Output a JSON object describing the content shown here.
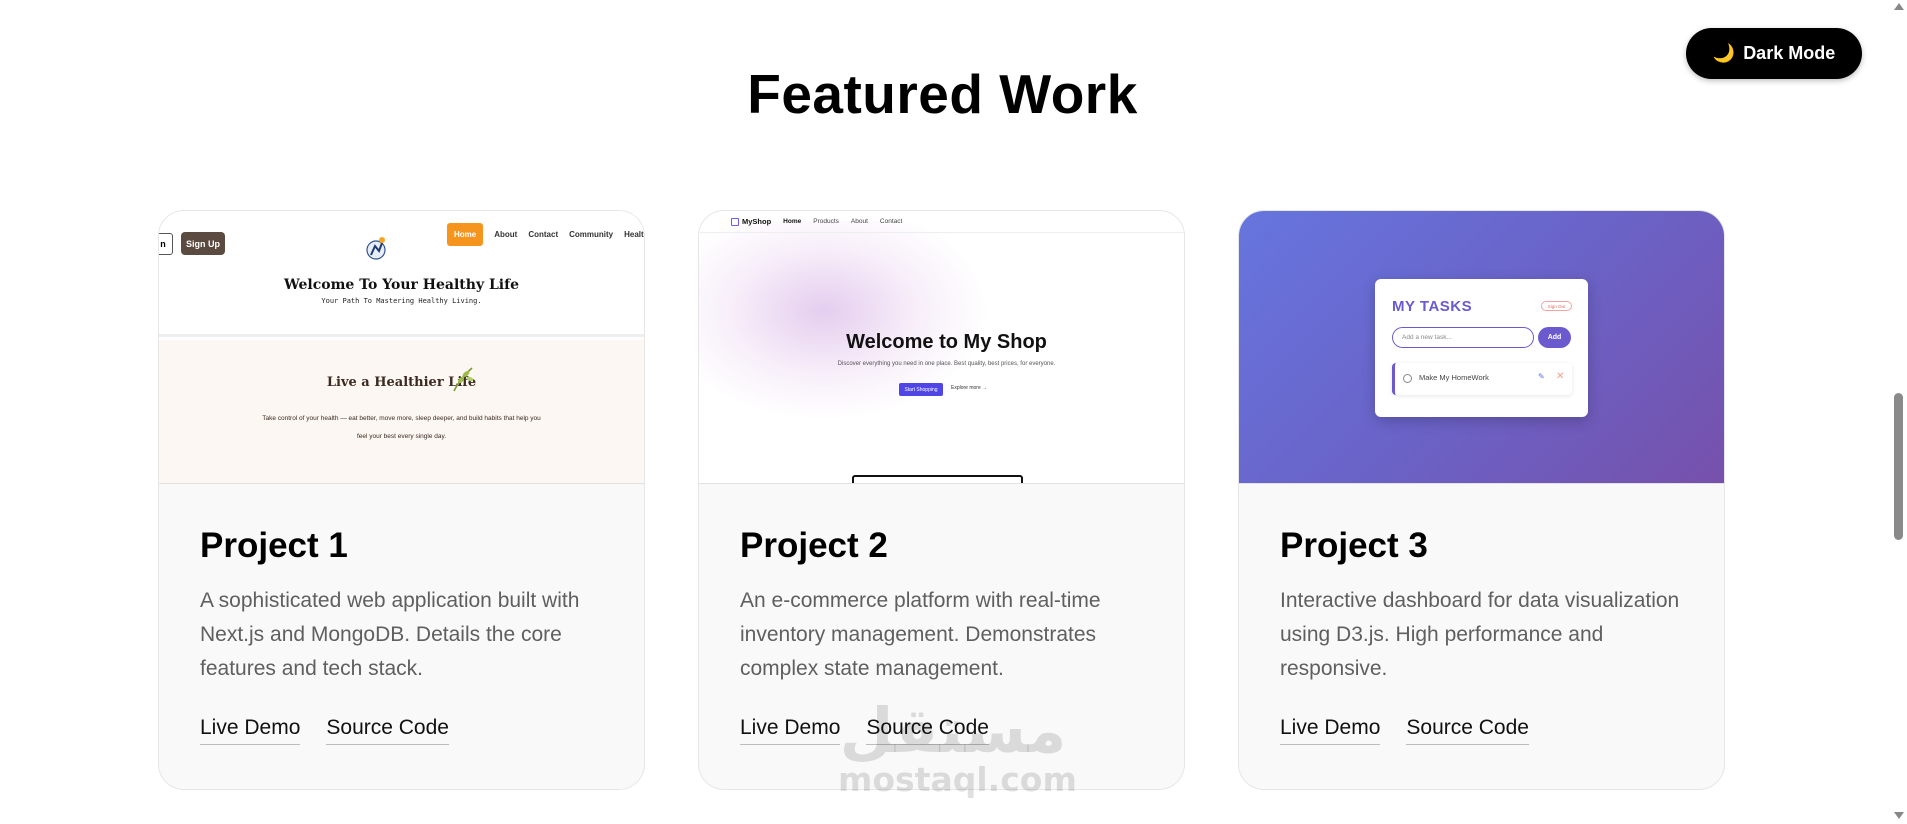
{
  "section": {
    "title": "Featured Work"
  },
  "dark_mode": {
    "icon": "moon-icon",
    "label": "Dark Mode"
  },
  "projects": [
    {
      "title": "Project 1",
      "description": "A sophisticated web application built with Next.js and MongoDB. Details the core features and tech stack.",
      "live_demo": "Live Demo",
      "source_code": "Source Code",
      "preview": {
        "login_btn": "n",
        "signup_btn": "Sign Up",
        "nav": [
          "Home",
          "About",
          "Contact",
          "Community",
          "Healt"
        ],
        "heading": "Welcome To Your Healthy Life",
        "subheading": "Your Path To Mastering Healthy Living.",
        "section_heading": "Live a Healthier Life",
        "paragraph_line1": "Take control of your health — eat better, move more, sleep deeper, and build habits that help you",
        "paragraph_line2": "feel your best every single day."
      }
    },
    {
      "title": "Project 2",
      "description": "An e-commerce platform with real-time inventory management. Demonstrates complex state management.",
      "live_demo": "Live Demo",
      "source_code": "Source Code",
      "preview": {
        "brand": "MyShop",
        "nav": [
          "Home",
          "Products",
          "About",
          "Contact"
        ],
        "heading": "Welcome to My Shop",
        "subheading": "Discover everything you need in one place. Best quality, best prices, for everyone.",
        "cta_primary": "Start Shopping",
        "cta_secondary": "Explore more →"
      }
    },
    {
      "title": "Project 3",
      "description": "Interactive dashboard for data visualization using D3.js. High performance and responsive.",
      "live_demo": "Live Demo",
      "source_code": "Source Code",
      "preview": {
        "panel_title": "MY TASKS",
        "signout": "Sign Out",
        "input_placeholder": "Add a new task...",
        "add_btn": "Add",
        "task": "Make My HomeWork",
        "edit_icon": "✎",
        "delete_icon": "✕"
      }
    }
  ],
  "watermark": {
    "arabic": "مستقل",
    "latin": "mostaql.com"
  },
  "colors": {
    "accent_orange": "#f5951e",
    "task_purple": "#6a5acd",
    "shop_indigo": "#4f46e5"
  }
}
